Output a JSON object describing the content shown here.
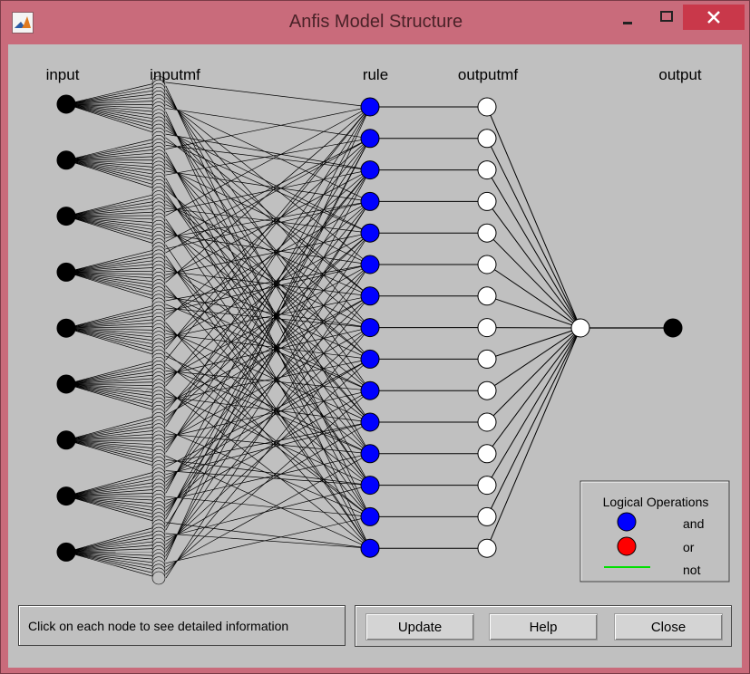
{
  "window": {
    "title": "Anfis Model Structure"
  },
  "layers": {
    "input": "input",
    "inputmf": "inputmf",
    "rule": "rule",
    "outputmf": "outputmf",
    "output": "output"
  },
  "network": {
    "input_count": 9,
    "inputmf_per_input": 15,
    "rule_count": 15,
    "outputmf_count": 15,
    "output_count": 1,
    "colors": {
      "input_node": "#000000",
      "rule_node": "#0000ff",
      "outputmf_node": "#ffffff",
      "aggregate_node": "#ffffff",
      "output_node": "#000000",
      "edge": "#000000"
    }
  },
  "legend": {
    "title": "Logical Operations",
    "items": [
      {
        "label": "and",
        "color": "#0000ff"
      },
      {
        "label": "or",
        "color": "#ff0000"
      },
      {
        "label": "not",
        "color": "#00e000"
      }
    ]
  },
  "status": {
    "text": "Click on each node to see detailed information"
  },
  "buttons": {
    "update": "Update",
    "help": "Help",
    "close": "Close"
  }
}
